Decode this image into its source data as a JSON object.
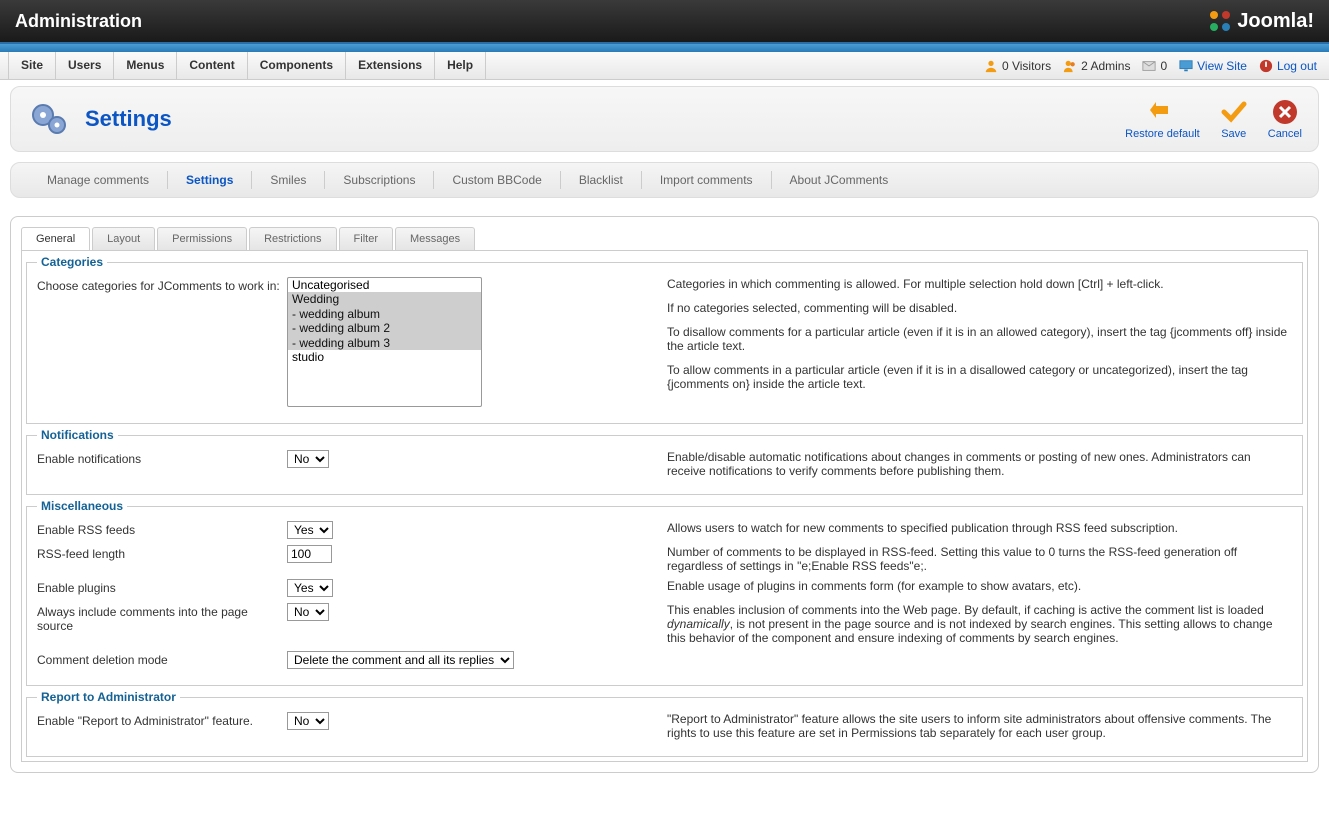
{
  "header": {
    "title": "Administration",
    "brand": "Joomla!"
  },
  "menubar": [
    "Site",
    "Users",
    "Menus",
    "Content",
    "Components",
    "Extensions",
    "Help"
  ],
  "status": {
    "visitors": "0 Visitors",
    "admins": "2 Admins",
    "messages": "0",
    "view_site": "View Site",
    "logout": "Log out"
  },
  "page": {
    "title": "Settings"
  },
  "toolbar": {
    "restore_default": "Restore default",
    "save": "Save",
    "cancel": "Cancel"
  },
  "subnav": {
    "items": [
      "Manage comments",
      "Settings",
      "Smiles",
      "Subscriptions",
      "Custom BBCode",
      "Blacklist",
      "Import comments",
      "About JComments"
    ],
    "active": "Settings"
  },
  "tabs": {
    "items": [
      "General",
      "Layout",
      "Permissions",
      "Restrictions",
      "Filter",
      "Messages"
    ],
    "active": "General"
  },
  "categories_section": {
    "legend": "Categories",
    "label": "Choose categories for JComments to work in:",
    "options": [
      {
        "text": "Uncategorised",
        "selected": false
      },
      {
        "text": "Wedding",
        "selected": true
      },
      {
        "text": " - wedding album",
        "selected": true
      },
      {
        "text": " - wedding album 2",
        "selected": true
      },
      {
        "text": " - wedding album 3",
        "selected": true
      },
      {
        "text": "studio",
        "selected": false
      }
    ],
    "desc_p1": "Categories in which commenting is allowed. For multiple selection hold down [Ctrl] + left-click.",
    "desc_p2": "If no categories selected, commenting will be disabled.",
    "desc_p3": "To disallow comments for a particular article (even if it is in an allowed category), insert the tag {jcomments off} inside the article text.",
    "desc_p4": "To allow comments in a particular article (even if it is in a disallowed category or uncategorized), insert the tag {jcomments on} inside the article text."
  },
  "notifications_section": {
    "legend": "Notifications",
    "label": "Enable notifications",
    "value": "No",
    "desc": "Enable/disable automatic notifications about changes in comments or posting of new ones. Administrators can receive notifications to verify comments before publishing them."
  },
  "misc_section": {
    "legend": "Miscellaneous",
    "rss_label": "Enable RSS feeds",
    "rss_value": "Yes",
    "rss_desc": "Allows users to watch for new comments to specified publication through RSS feed subscription.",
    "rsslen_label": "RSS-feed length",
    "rsslen_value": "100",
    "rsslen_desc": "Number of comments to be displayed in RSS-feed. Setting this value to 0 turns the RSS-feed generation off regardless of settings in \"e;Enable RSS feeds\"e;.",
    "plugins_label": "Enable plugins",
    "plugins_value": "Yes",
    "plugins_desc": "Enable usage of plugins in comments form (for example to show avatars, etc).",
    "include_label": "Always include comments into the page source",
    "include_value": "No",
    "include_desc_pre": "This enables inclusion of comments into the Web page. By default, if caching is active the comment list is loaded ",
    "include_desc_em": "dynamically",
    "include_desc_post": ", is not present in the page source and is not indexed by search engines. This setting allows to change this behavior of the component and ensure indexing of comments by search engines.",
    "delete_label": "Comment deletion mode",
    "delete_value": "Delete the comment and all its replies"
  },
  "report_section": {
    "legend": "Report to Administrator",
    "label": "Enable \"Report to Administrator\" feature.",
    "value": "No",
    "desc": "\"Report to Administrator\" feature allows the site users to inform site administrators about offensive comments. The rights to use this feature are set in Permissions tab separately for each user group."
  }
}
